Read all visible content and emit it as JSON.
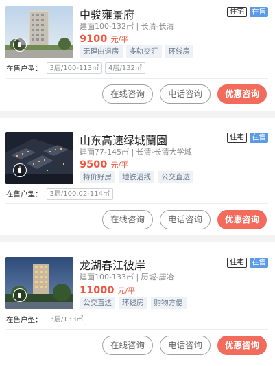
{
  "listings": [
    {
      "name": "中骏雍景府",
      "type_badge": "住宅",
      "status_badge": "在售",
      "meta": "建面100-132㎡ | 长清-长清",
      "price": "9100",
      "price_unit": "元/平",
      "tags": [
        "无理由退房",
        "多轨交汇",
        "环线房"
      ],
      "units_label": "在售户型：",
      "units": [
        "3居/100-113㎡",
        "4居/132㎡"
      ],
      "thumb": "tower-day",
      "thumb_icon": "video-play-icon"
    },
    {
      "name": "山东高速绿城蘭園",
      "type_badge": "住宅",
      "status_badge": "在售",
      "meta": "建面77-145㎡ | 长清-长清大学城",
      "price": "9500",
      "price_unit": "元/平",
      "tags": [
        "特价好房",
        "地铁沿线",
        "公交直达"
      ],
      "units_label": "在售户型：",
      "units": [
        "3居/100.02-114㎡"
      ],
      "thumb": "aerial-night",
      "thumb_icon": "video-play-icon"
    },
    {
      "name": "龙湖春江彼岸",
      "type_badge": "住宅",
      "status_badge": "在售",
      "meta": "建面100-133㎡ | 历城-唐冶",
      "price": "11000",
      "price_unit": "元/平",
      "tags": [
        "公交直达",
        "环线房",
        "购物方便"
      ],
      "units_label": "在售户型：",
      "units": [
        "3居/133㎡"
      ],
      "thumb": "tower-dusk",
      "thumb_icon": "video-play-icon"
    }
  ],
  "buttons": {
    "online": "在线咨询",
    "phone": "电话咨询",
    "discount": "优惠咨询"
  },
  "colors": {
    "price": "#f0553f",
    "status_badge": "#5a9ae6",
    "primary_button": "#f36b5b",
    "tag_bg": "#eef1f5"
  }
}
